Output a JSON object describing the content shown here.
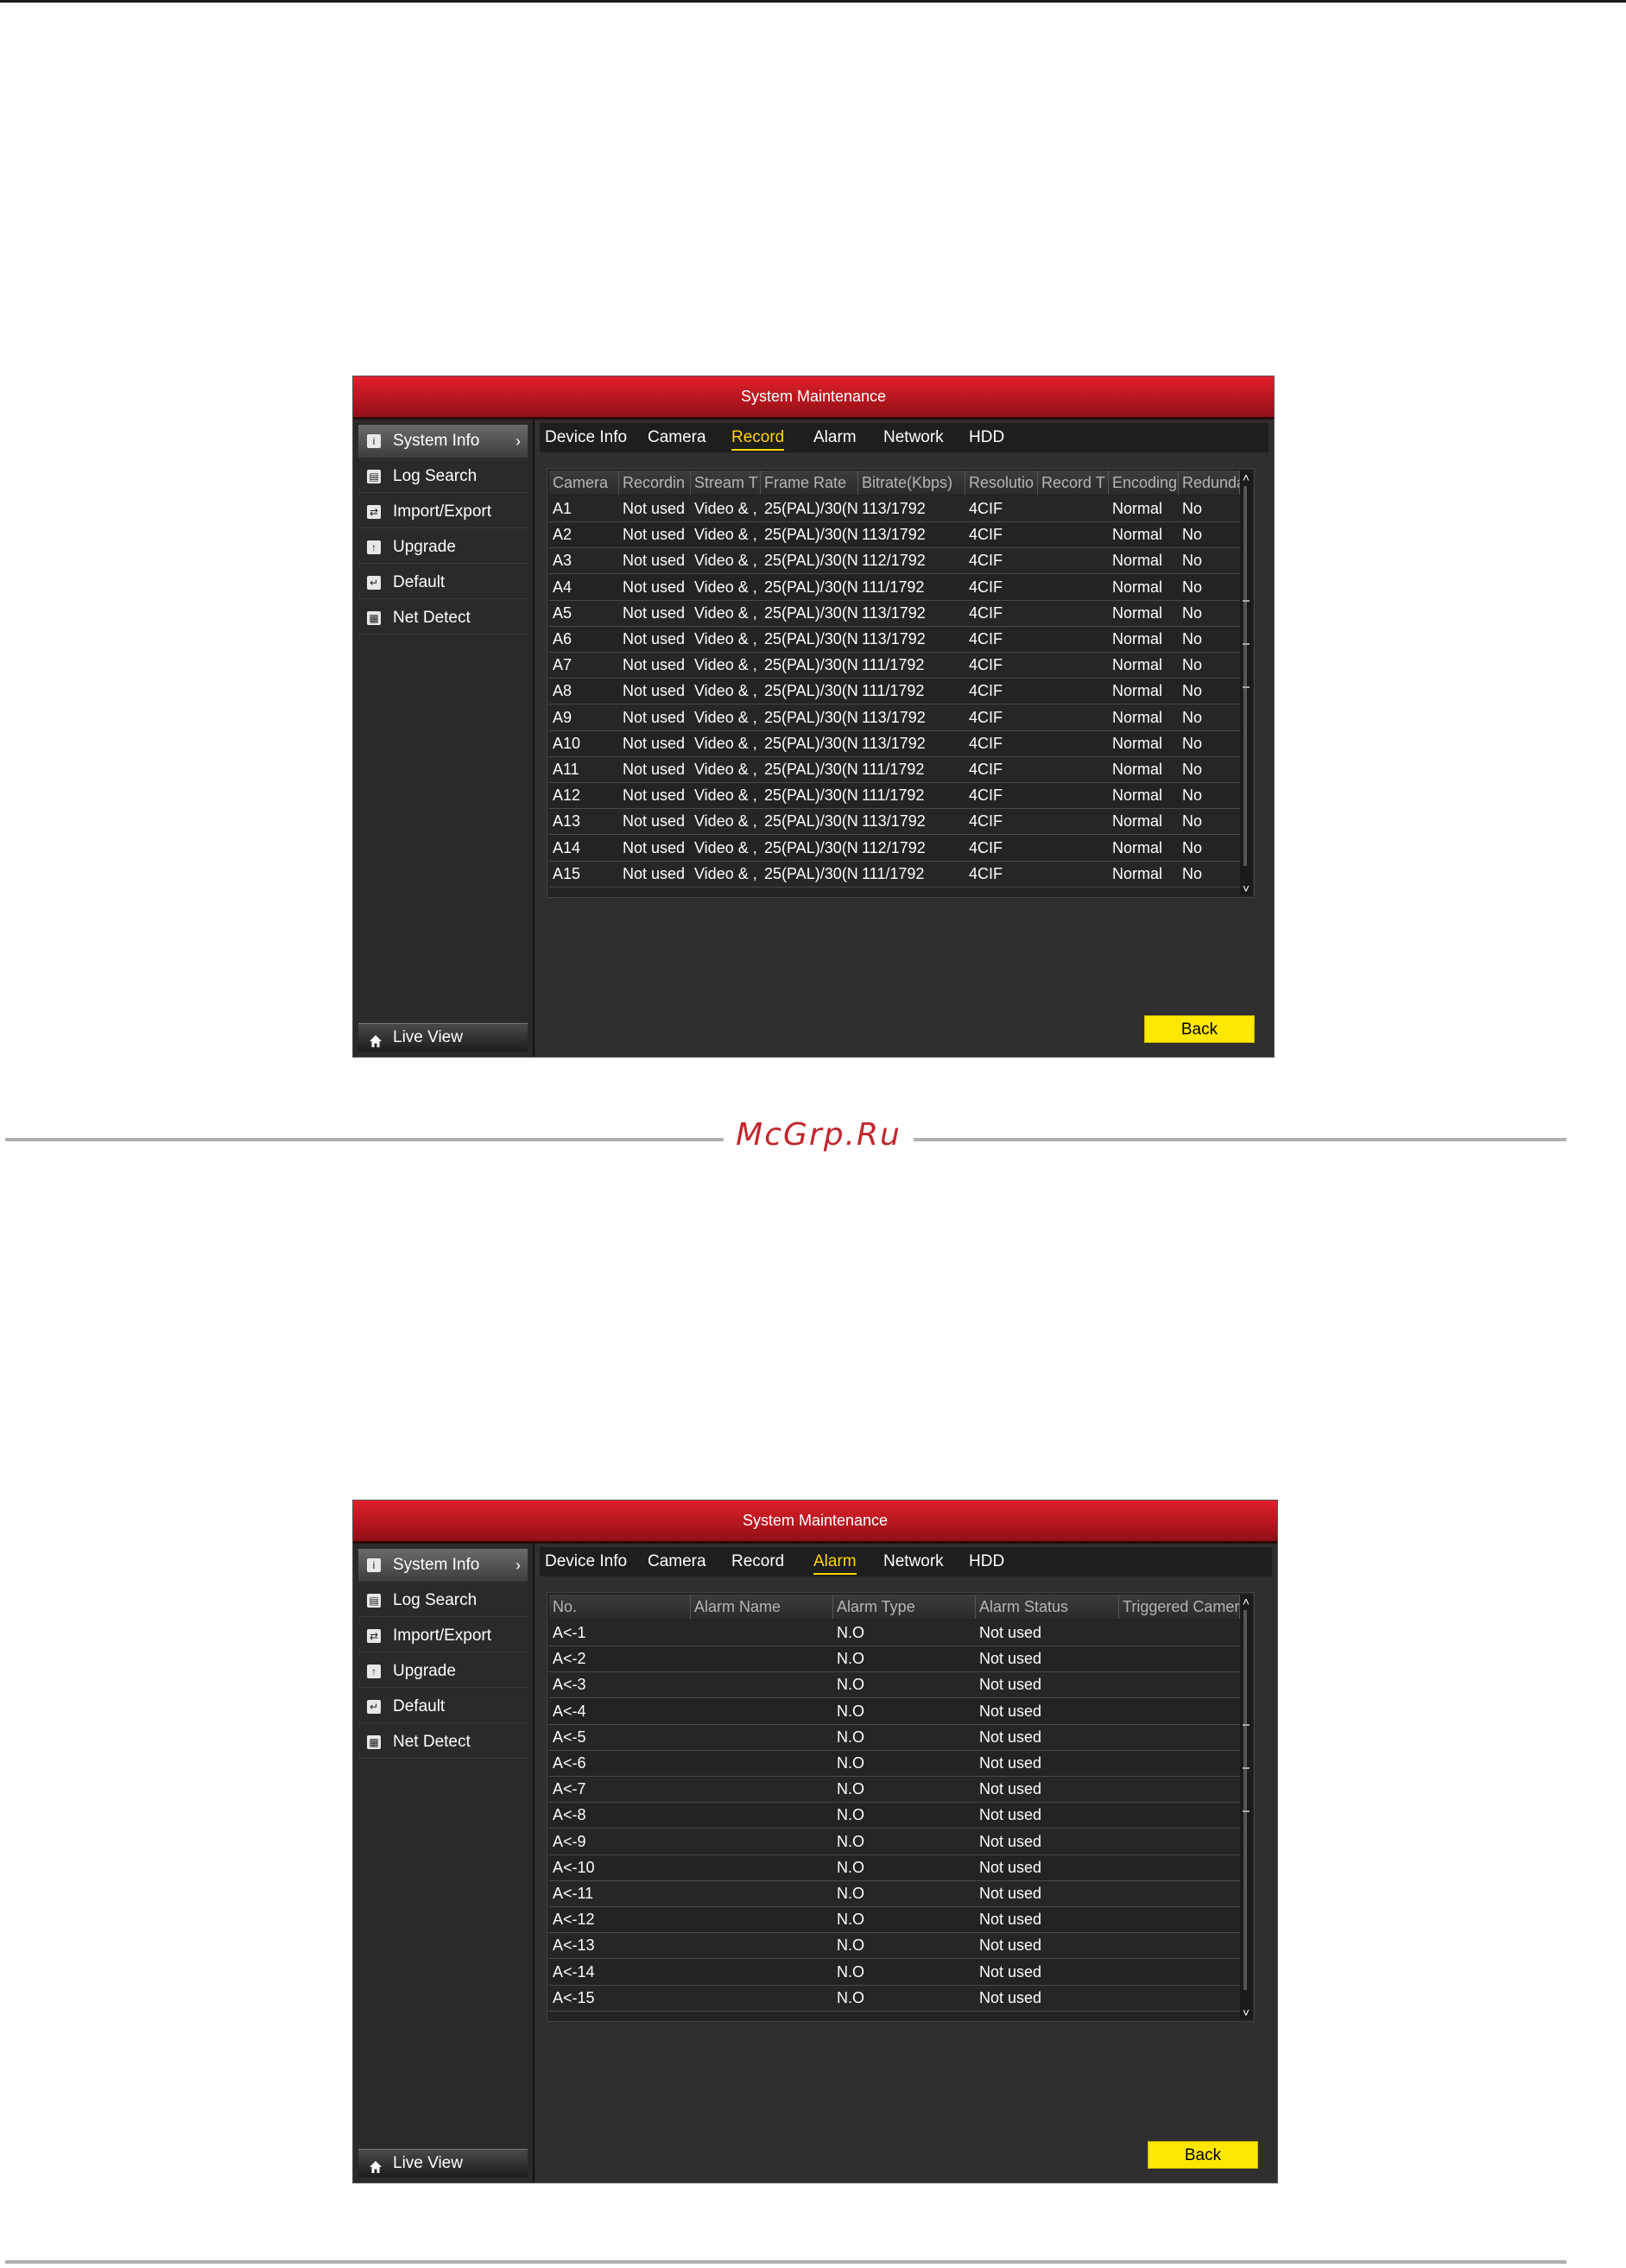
{
  "watermark": "McGrp.Ru",
  "panels": [
    {
      "title": "System Maintenance",
      "sidebar": [
        {
          "label": "System Info",
          "icon": "info-icon"
        },
        {
          "label": "Log Search",
          "icon": "log-search-icon"
        },
        {
          "label": "Import/Export",
          "icon": "import-export-icon"
        },
        {
          "label": "Upgrade",
          "icon": "upgrade-icon"
        },
        {
          "label": "Default",
          "icon": "default-icon"
        },
        {
          "label": "Net Detect",
          "icon": "net-detect-icon"
        }
      ],
      "live_view": "Live View",
      "tabs": [
        "Device Info",
        "Camera",
        "Record",
        "Alarm",
        "Network",
        "HDD"
      ],
      "active_tab": "Record",
      "columns": [
        "Camera",
        "Recordin",
        "Stream T",
        "Frame Rate",
        "Bitrate(Kbps)",
        "Resolutio",
        "Record T",
        "Encoding",
        "Redunda"
      ],
      "rows": [
        [
          "A1",
          "Not used",
          "Video & ,",
          "25(PAL)/30(N",
          "113/1792",
          "4CIF",
          "",
          "Normal",
          "No"
        ],
        [
          "A2",
          "Not used",
          "Video & ,",
          "25(PAL)/30(N",
          "113/1792",
          "4CIF",
          "",
          "Normal",
          "No"
        ],
        [
          "A3",
          "Not used",
          "Video & ,",
          "25(PAL)/30(N",
          "112/1792",
          "4CIF",
          "",
          "Normal",
          "No"
        ],
        [
          "A4",
          "Not used",
          "Video & ,",
          "25(PAL)/30(N",
          "111/1792",
          "4CIF",
          "",
          "Normal",
          "No"
        ],
        [
          "A5",
          "Not used",
          "Video & ,",
          "25(PAL)/30(N",
          "113/1792",
          "4CIF",
          "",
          "Normal",
          "No"
        ],
        [
          "A6",
          "Not used",
          "Video & ,",
          "25(PAL)/30(N",
          "113/1792",
          "4CIF",
          "",
          "Normal",
          "No"
        ],
        [
          "A7",
          "Not used",
          "Video & ,",
          "25(PAL)/30(N",
          "111/1792",
          "4CIF",
          "",
          "Normal",
          "No"
        ],
        [
          "A8",
          "Not used",
          "Video & ,",
          "25(PAL)/30(N",
          "111/1792",
          "4CIF",
          "",
          "Normal",
          "No"
        ],
        [
          "A9",
          "Not used",
          "Video & ,",
          "25(PAL)/30(N",
          "113/1792",
          "4CIF",
          "",
          "Normal",
          "No"
        ],
        [
          "A10",
          "Not used",
          "Video & ,",
          "25(PAL)/30(N",
          "113/1792",
          "4CIF",
          "",
          "Normal",
          "No"
        ],
        [
          "A11",
          "Not used",
          "Video & ,",
          "25(PAL)/30(N",
          "111/1792",
          "4CIF",
          "",
          "Normal",
          "No"
        ],
        [
          "A12",
          "Not used",
          "Video & ,",
          "25(PAL)/30(N",
          "111/1792",
          "4CIF",
          "",
          "Normal",
          "No"
        ],
        [
          "A13",
          "Not used",
          "Video & ,",
          "25(PAL)/30(N",
          "113/1792",
          "4CIF",
          "",
          "Normal",
          "No"
        ],
        [
          "A14",
          "Not used",
          "Video & ,",
          "25(PAL)/30(N",
          "112/1792",
          "4CIF",
          "",
          "Normal",
          "No"
        ],
        [
          "A15",
          "Not used",
          "Video & ,",
          "25(PAL)/30(N",
          "111/1792",
          "4CIF",
          "",
          "Normal",
          "No"
        ]
      ],
      "back": "Back"
    },
    {
      "title": "System Maintenance",
      "sidebar": [
        {
          "label": "System Info",
          "icon": "info-icon"
        },
        {
          "label": "Log Search",
          "icon": "log-search-icon"
        },
        {
          "label": "Import/Export",
          "icon": "import-export-icon"
        },
        {
          "label": "Upgrade",
          "icon": "upgrade-icon"
        },
        {
          "label": "Default",
          "icon": "default-icon"
        },
        {
          "label": "Net Detect",
          "icon": "net-detect-icon"
        }
      ],
      "live_view": "Live View",
      "tabs": [
        "Device Info",
        "Camera",
        "Record",
        "Alarm",
        "Network",
        "HDD"
      ],
      "active_tab": "Alarm",
      "columns": [
        "No.",
        "Alarm Name",
        "Alarm Type",
        "Alarm Status",
        "Triggered Camera"
      ],
      "rows": [
        [
          "A<-1",
          "",
          "N.O",
          "Not used",
          ""
        ],
        [
          "A<-2",
          "",
          "N.O",
          "Not used",
          ""
        ],
        [
          "A<-3",
          "",
          "N.O",
          "Not used",
          ""
        ],
        [
          "A<-4",
          "",
          "N.O",
          "Not used",
          ""
        ],
        [
          "A<-5",
          "",
          "N.O",
          "Not used",
          ""
        ],
        [
          "A<-6",
          "",
          "N.O",
          "Not used",
          ""
        ],
        [
          "A<-7",
          "",
          "N.O",
          "Not used",
          ""
        ],
        [
          "A<-8",
          "",
          "N.O",
          "Not used",
          ""
        ],
        [
          "A<-9",
          "",
          "N.O",
          "Not used",
          ""
        ],
        [
          "A<-10",
          "",
          "N.O",
          "Not used",
          ""
        ],
        [
          "A<-11",
          "",
          "N.O",
          "Not used",
          ""
        ],
        [
          "A<-12",
          "",
          "N.O",
          "Not used",
          ""
        ],
        [
          "A<-13",
          "",
          "N.O",
          "Not used",
          ""
        ],
        [
          "A<-14",
          "",
          "N.O",
          "Not used",
          ""
        ],
        [
          "A<-15",
          "",
          "N.O",
          "Not used",
          ""
        ]
      ],
      "back": "Back"
    }
  ]
}
